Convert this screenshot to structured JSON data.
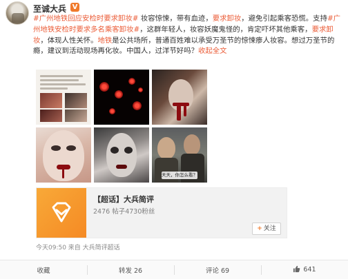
{
  "post": {
    "username": "至诚大兵",
    "verified_badge": "V",
    "body": [
      {
        "text": "#广州地铁回应安检时要求卸妆#",
        "style": "hl"
      },
      {
        "text": " 妆容惊悚，带有血迹，",
        "style": ""
      },
      {
        "text": "要求卸妆",
        "style": "hl"
      },
      {
        "text": "，避免引起乘客恐慌。支持",
        "style": ""
      },
      {
        "text": "#广州地铁安检时要求多名乘客卸妆#",
        "style": "hl"
      },
      {
        "text": "，这群年轻人，妆容妖魔鬼怪的，肯定吓坏其他乘客，",
        "style": ""
      },
      {
        "text": "要求卸妆",
        "style": "hl"
      },
      {
        "text": "，体现人性关怀。",
        "style": ""
      },
      {
        "text": "地铁",
        "style": "hl"
      },
      {
        "text": "是公共场所，普通百姓难以承受万圣节的惊悚瘆人妆容。想过万圣节的瘾，建议到活动现场再化妆。中国人，过洋节好吗？",
        "style": ""
      },
      {
        "text": "收起全文",
        "style": "expand"
      }
    ],
    "images": [
      {
        "name": "news-screenshot"
      },
      {
        "name": "red-lights-dark"
      },
      {
        "name": "bloody-vampire-makeup"
      },
      {
        "name": "bloody-lips-makeup"
      },
      {
        "name": "zombie-makeup"
      },
      {
        "name": "tv-drama-still",
        "subtitle": "天天，你怎么看？"
      }
    ]
  },
  "supertopic": {
    "title": "【超话】大兵简评",
    "stats": "2476 帖子4730粉丝",
    "follow_label": "关注",
    "follow_plus": "+"
  },
  "meta": {
    "text": "今天09:50 来自 大兵简评超话"
  },
  "actions": {
    "favorite": "收藏",
    "repost": "转发 26",
    "comment": "评论 69",
    "like": "641"
  },
  "colors": {
    "link": "#eb5d38",
    "accent": "#f07a2b"
  }
}
